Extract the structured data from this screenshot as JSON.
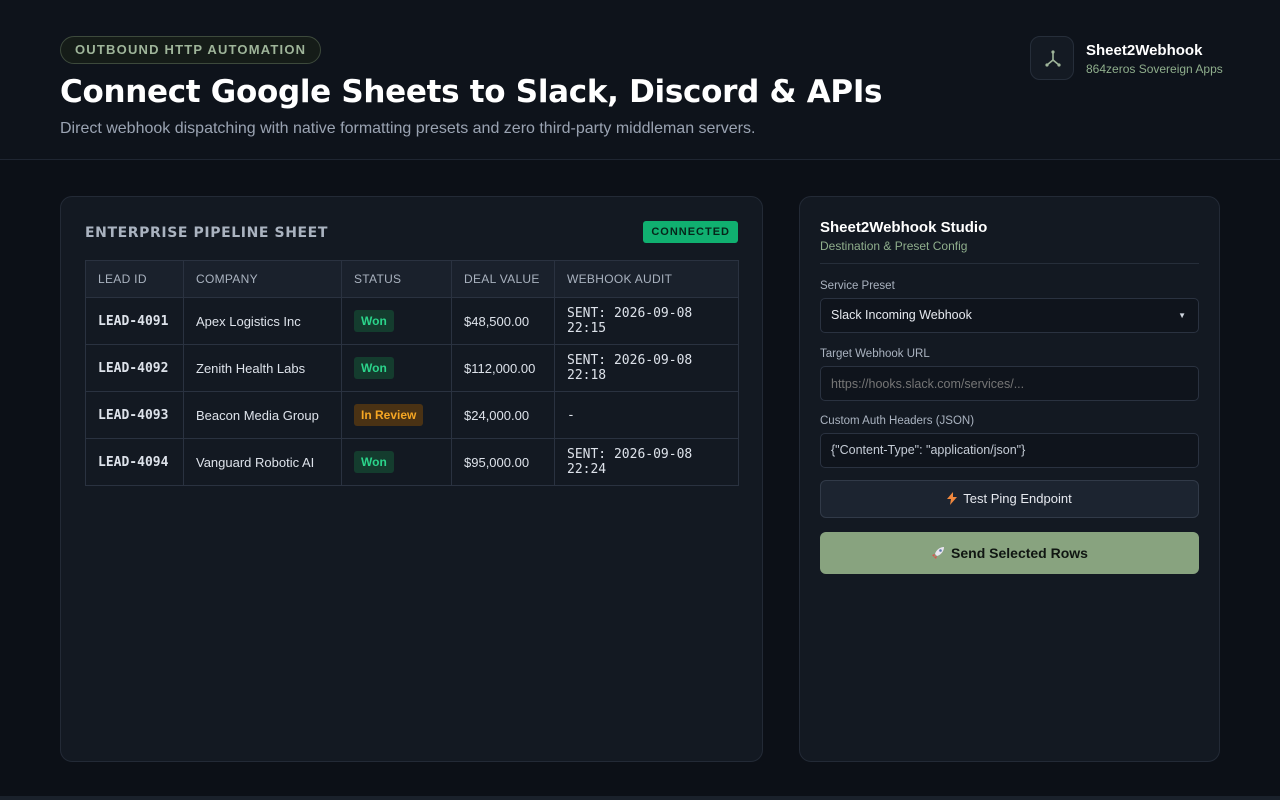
{
  "header": {
    "eyebrow": "OUTBOUND HTTP AUTOMATION",
    "title": "Connect Google Sheets to Slack, Discord & APIs",
    "subtitle": "Direct webhook dispatching with native formatting presets and zero third-party middleman servers.",
    "brand_name": "Sheet2Webhook",
    "brand_sub": "864zeros Sovereign Apps"
  },
  "sheet": {
    "title": "ENTERPRISE PIPELINE SHEET",
    "status_badge": "CONNECTED",
    "columns": [
      "LEAD ID",
      "COMPANY",
      "STATUS",
      "DEAL VALUE",
      "WEBHOOK AUDIT"
    ],
    "rows": [
      {
        "lead_id": "LEAD-4091",
        "company": "Apex Logistics Inc",
        "status": "Won",
        "deal_value": "$48,500.00",
        "audit": "SENT: 2026-09-08 22:15"
      },
      {
        "lead_id": "LEAD-4092",
        "company": "Zenith Health Labs",
        "status": "Won",
        "deal_value": "$112,000.00",
        "audit": "SENT: 2026-09-08 22:18"
      },
      {
        "lead_id": "LEAD-4093",
        "company": "Beacon Media Group",
        "status": "In Review",
        "deal_value": "$24,000.00",
        "audit": "-"
      },
      {
        "lead_id": "LEAD-4094",
        "company": "Vanguard Robotic AI",
        "status": "Won",
        "deal_value": "$95,000.00",
        "audit": "SENT: 2026-09-08 22:24"
      }
    ]
  },
  "studio": {
    "title": "Sheet2Webhook Studio",
    "subtitle": "Destination & Preset Config",
    "preset_label": "Service Preset",
    "preset_value": "Slack Incoming Webhook",
    "url_label": "Target Webhook URL",
    "url_placeholder": "https://hooks.slack.com/services/...",
    "headers_label": "Custom Auth Headers (JSON)",
    "headers_value": "{\"Content-Type\": \"application/json\"}",
    "test_button": "Test Ping Endpoint",
    "send_button": "Send Selected Rows"
  },
  "icons": {
    "brand_logo": "webhook-icon",
    "test_button_icon": "lightning-icon",
    "send_button_icon": "rocket-icon",
    "select_caret": "caret-down-icon"
  },
  "colors": {
    "accent_green": "#10b070",
    "sage": "#88a37f",
    "won_text": "#2bd48b",
    "review_text": "#f5a623"
  }
}
